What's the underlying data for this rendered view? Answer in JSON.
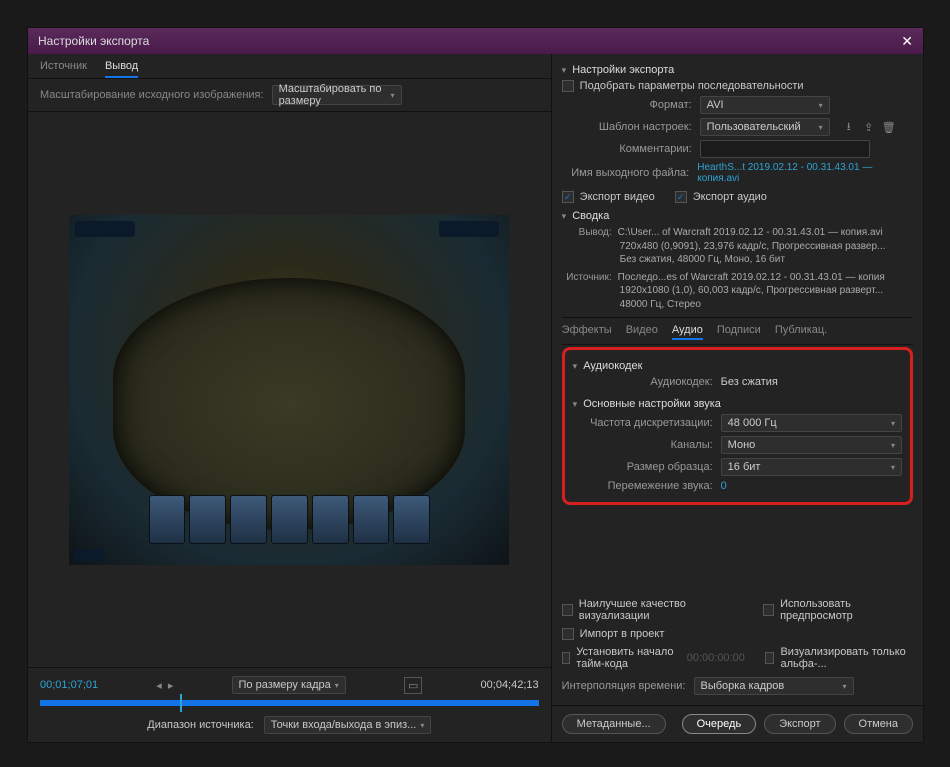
{
  "window": {
    "title": "Настройки экспорта"
  },
  "leftTabs": {
    "source": "Источник",
    "output": "Вывод"
  },
  "scaleRow": {
    "label": "Масштабирование исходного изображения:",
    "value": "Масштабировать по размеру"
  },
  "timeline": {
    "in": "00;01;07;01",
    "out": "00;04;42;13",
    "fit": "По размеру кадра",
    "rangeLabel": "Диапазон источника:",
    "rangeValue": "Точки входа/выхода в эпиз..."
  },
  "export": {
    "header": "Настройки экспорта",
    "matchSeq": "Подобрать параметры последовательности",
    "formatLabel": "Формат:",
    "formatValue": "AVI",
    "presetLabel": "Шаблон настроек:",
    "presetValue": "Пользовательский",
    "commentsLabel": "Комментарии:",
    "outputNameLabel": "Имя выходного файла:",
    "outputName": "HearthS...t 2019.02.12 - 00.31.43.01 — копия.avi",
    "exportVideo": "Экспорт видео",
    "exportAudio": "Экспорт аудио"
  },
  "summary": {
    "header": "Сводка",
    "outputLabel": "Вывод:",
    "output": "C:\\User... of Warcraft 2019.02.12 - 00.31.43.01 — копия.avi\n720x480 (0,9091), 23,976 кадр/с, Прогрессивная развер...\nБез сжатия, 48000 Гц, Моно, 16 бит",
    "sourceLabel": "Источник:",
    "source": "Последо...es of Warcraft 2019.02.12 - 00.31.43.01 — копия\n1920x1080 (1,0), 60,003 кадр/с, Прогрессивная разверт...\n48000 Гц, Стерео"
  },
  "tabs2": {
    "effects": "Эффекты",
    "video": "Видео",
    "audio": "Аудио",
    "captions": "Подписи",
    "publish": "Публикац."
  },
  "audio": {
    "codecHeader": "Аудиокодек",
    "codecLabel": "Аудиокодек:",
    "codecValue": "Без сжатия",
    "basicHeader": "Основные настройки звука",
    "sampleRateLabel": "Частота дискретизации:",
    "sampleRateValue": "48 000 Гц",
    "channelsLabel": "Каналы:",
    "channelsValue": "Моно",
    "sampleSizeLabel": "Размер образца:",
    "sampleSizeValue": "16 бит",
    "interleaveLabel": "Перемежение звука:",
    "interleaveValue": "0"
  },
  "bottom": {
    "maxQuality": "Наилучшее качество визуализации",
    "usePreviews": "Использовать предпросмотр",
    "importProject": "Импорт в проект",
    "setStart": "Установить начало тайм-кода",
    "setStartTime": "00:00:00:00",
    "alphaOnly": "Визуализировать только альфа-...",
    "interpLabel": "Интерполяция времени:",
    "interpValue": "Выборка кадров"
  },
  "buttons": {
    "metadata": "Метаданные...",
    "queue": "Очередь",
    "export": "Экспорт",
    "cancel": "Отмена"
  }
}
